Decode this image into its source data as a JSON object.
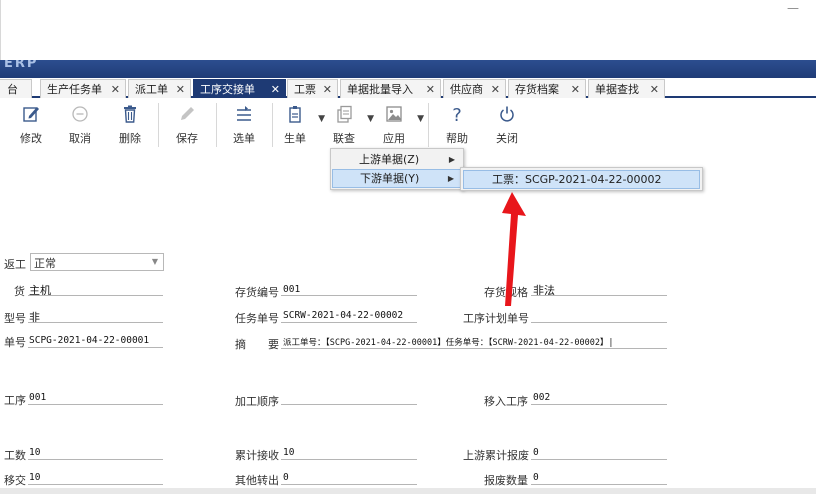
{
  "window": {
    "minimize_glyph": "—",
    "app_title": "ERP"
  },
  "tabs": [
    {
      "label": "台",
      "active": false
    },
    {
      "label": "生产任务单",
      "active": false
    },
    {
      "label": "派工单",
      "active": false
    },
    {
      "label": "工序交接单",
      "active": true
    },
    {
      "label": "工票",
      "active": false
    },
    {
      "label": "单据批量导入",
      "active": false
    },
    {
      "label": "供应商",
      "active": false
    },
    {
      "label": "存货档案",
      "active": false
    },
    {
      "label": "单据查找",
      "active": false
    }
  ],
  "tab_close": "✕",
  "toolbar": {
    "edit": "修改",
    "cancel": "取消",
    "delete": "删除",
    "save": "保存",
    "select": "选单",
    "generate": "生单",
    "query": "联查",
    "apply": "应用",
    "help": "帮助",
    "close": "关闭"
  },
  "context_menu": {
    "upstream": "上游单据(Z)",
    "downstream": "下游单据(Y)",
    "sub_item": "工票：SCGP-2021-04-22-00002"
  },
  "form": {
    "rework_label": "返工",
    "rework_value": "正常",
    "goods_label": "货",
    "goods_value": "主机",
    "stock_code_label": "存货编号",
    "stock_code_value": "001",
    "stock_spec_label": "存货规格",
    "stock_spec_value": "非法",
    "model_label": "型号",
    "model_value": "非",
    "task_no_label": "任务单号",
    "task_no_value": "SCRW-2021-04-22-00002",
    "process_plan_label": "工序计划单号",
    "process_plan_value": "",
    "dispatch_no_label": "单号",
    "dispatch_no_value": "SCPG-2021-04-22-00001",
    "summary_label": "摘　　要",
    "summary_value": "派工单号：【SCPG-2021-04-22-00001】任务单号：【SCRW-2021-04-22-00002】|",
    "process_label": "工序",
    "process_value": "001",
    "proc_order_label": "加工顺序",
    "proc_order_value": "",
    "move_in_label": "移入工序",
    "move_in_value": "002",
    "work_qty_label": "工数",
    "work_qty_value": "10",
    "cum_receive_label": "累计接收",
    "cum_receive_value": "10",
    "up_scrap_label": "上游累计报废",
    "up_scrap_value": "0",
    "transfer_label": "移交",
    "transfer_value": "10",
    "other_out_label": "其他转出",
    "other_out_value": "0",
    "scrap_qty_label": "报废数量",
    "scrap_qty_value": "0"
  },
  "annotation": {
    "arrow_color": "#e8161b"
  },
  "colors": {
    "accent": "#1e3a74",
    "menu_highlight": "#cfe3f8"
  }
}
